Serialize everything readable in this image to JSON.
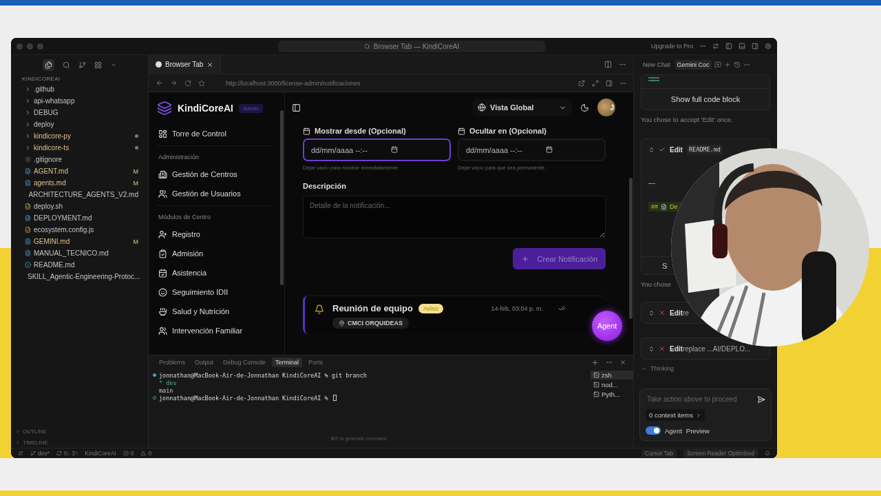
{
  "window": {
    "search": "Browser Tab — KindiCoreAI",
    "upgrade": "Upgrade to Pro"
  },
  "explorer": {
    "title": "KINDICOREAI",
    "items": [
      {
        "name": ".github",
        "kind": "folder",
        "modified": false
      },
      {
        "name": "api-whatsapp",
        "kind": "folder",
        "modified": false
      },
      {
        "name": "DEBUG",
        "kind": "folder",
        "modified": false
      },
      {
        "name": "deploy",
        "kind": "folder",
        "modified": false
      },
      {
        "name": "kindicore-py",
        "kind": "folder",
        "modified": true
      },
      {
        "name": "kindicore-ts",
        "kind": "folder",
        "modified": true
      },
      {
        "name": ".gitignore",
        "kind": "ignore",
        "modified": false
      },
      {
        "name": "AGENT.md",
        "kind": "markdown",
        "modified": true,
        "badge": "M"
      },
      {
        "name": "agents.md",
        "kind": "markdown",
        "modified": true,
        "badge": "M"
      },
      {
        "name": "ARCHITECTURE_AGENTS_V2.md",
        "kind": "markdown",
        "modified": false
      },
      {
        "name": "deploy.sh",
        "kind": "shell",
        "modified": false
      },
      {
        "name": "DEPLOYMENT.md",
        "kind": "markdown",
        "modified": false
      },
      {
        "name": "ecosystem.config.js",
        "kind": "script",
        "modified": false
      },
      {
        "name": "GEMINI.md",
        "kind": "markdown",
        "modified": true,
        "badge": "M"
      },
      {
        "name": "MANUAL_TECNICO.md",
        "kind": "markdown",
        "modified": false
      },
      {
        "name": "README.md",
        "kind": "info",
        "modified": false
      },
      {
        "name": "SKILL_Agentic-Engineering-Protoc...",
        "kind": "markdown",
        "modified": false
      }
    ],
    "sections": [
      "OUTLINE",
      "TIMELINE"
    ]
  },
  "editor_tab": {
    "label": "Browser Tab",
    "selected": true
  },
  "url": "http://localhost:3000/license-admin/notificaciones",
  "app": {
    "brand": "KindiCoreAI",
    "role": "Admin",
    "nav": [
      {
        "kind": "item",
        "label": "Torre de Control"
      },
      {
        "kind": "section",
        "label": "Administración"
      },
      {
        "kind": "item",
        "label": "Gestión de Centros"
      },
      {
        "kind": "item",
        "label": "Gestión de Usuarios"
      },
      {
        "kind": "section",
        "label": "Módulos de Centro"
      },
      {
        "kind": "item",
        "label": "Registro"
      },
      {
        "kind": "item",
        "label": "Admisión"
      },
      {
        "kind": "item",
        "label": "Asistencia"
      },
      {
        "kind": "item",
        "label": "Seguimiento IDII"
      },
      {
        "kind": "item",
        "label": "Salud y Nutrición"
      },
      {
        "kind": "item",
        "label": "Intervención Familiar"
      }
    ],
    "scope": "Vista Global",
    "avatar_letter": "J",
    "fields": [
      {
        "label": "Mostrar desde (Opcional)",
        "placeholder": "dd/mm/aaaa --:--",
        "hint": "Dejar vacío para mostrar inmediatamente.",
        "focused": true
      },
      {
        "label": "Ocultar en (Opcional)",
        "placeholder": "dd/mm/aaaa --:--",
        "hint": "Dejar vacío para que sea permanente.",
        "focused": false
      }
    ],
    "description": {
      "label": "Descripción",
      "placeholder": "Detalle de la notificación..."
    },
    "create_button": {
      "label": "Crear Notificación",
      "disabled": true
    },
    "notification": {
      "title": "Reunión de equipo",
      "tag": "Aviso",
      "center": "CMCI ORQUIDEAS",
      "time": "14-feb, 03:04 p. m.",
      "read": true
    },
    "agent_button": "Agent"
  },
  "panel": {
    "tabs": [
      {
        "label": "Problems",
        "selected": false
      },
      {
        "label": "Output",
        "selected": false
      },
      {
        "label": "Debug Console",
        "selected": false
      },
      {
        "label": "Terminal",
        "selected": true
      },
      {
        "label": "Ports",
        "selected": false
      }
    ],
    "lines": [
      {
        "kind": "prompt",
        "text": "jonnathan@MacBook-Air-de-Jonnathan KindiCoreAI % git branch"
      },
      {
        "kind": "current-branch",
        "text": "* dev"
      },
      {
        "kind": "branch",
        "text": "main"
      },
      {
        "kind": "prompt",
        "text": "jonnathan@MacBook-Air-de-Jonnathan KindiCoreAI %",
        "cursor": true
      }
    ],
    "hint": "⌘K to generate command",
    "terminals": [
      {
        "label": "zsh",
        "selected": true
      },
      {
        "label": "nod...",
        "selected": false
      },
      {
        "label": "Pyth...",
        "selected": false
      }
    ]
  },
  "status_bar": {
    "branch": "dev*",
    "sync": "0↓ 3↑",
    "project": "KindiCoreAI",
    "errors": "0",
    "warnings": "0",
    "right": [
      "Cursor Tab",
      "Screen Reader Optimized"
    ]
  },
  "chat": {
    "tabs": [
      {
        "label": "New Chat",
        "selected": false
      },
      {
        "label": "Gemini Coc",
        "selected": true
      }
    ],
    "show_code": "Show full code block",
    "note_1": "You chose to accept 'Edit' once.",
    "edit_card": {
      "kind": "accepted",
      "action": "Edit",
      "file": "README.md",
      "line_1": "---",
      "heading_marks": "##",
      "heading_text": "De",
      "button": "S"
    },
    "note_2": "You chose",
    "cards": [
      {
        "kind": "rejected",
        "action": "Edit",
        "rest": "re"
      },
      {
        "kind": "rejected",
        "action": "Edit",
        "rest": "replace",
        "path": "...AI/DEPLO..."
      }
    ],
    "thinking": "Thinking",
    "input_placeholder": "Take action above to proceed",
    "context": "0 context items",
    "agent_toggle": {
      "label": "Agent",
      "on": true
    },
    "preview": "Preview"
  }
}
